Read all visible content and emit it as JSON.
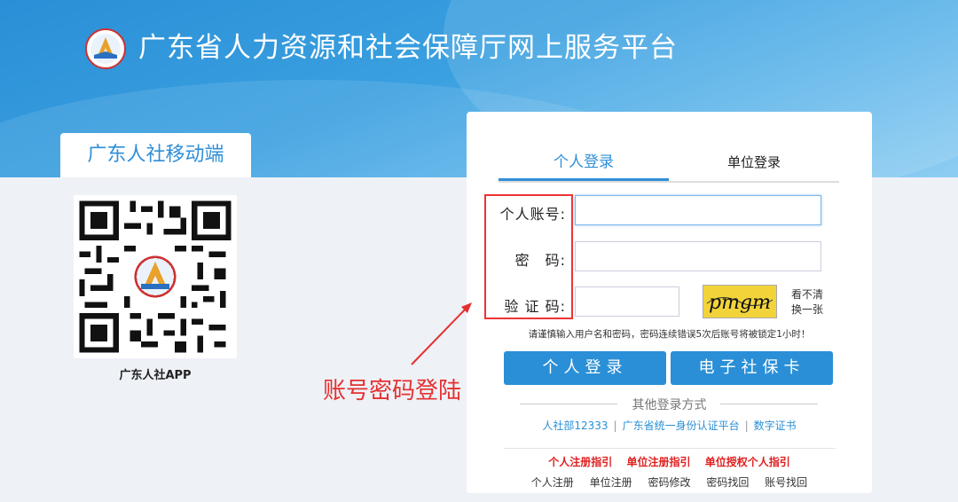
{
  "header": {
    "title": "广东省人力资源和社会保障厅网上服务平台",
    "logo_icon": "guangdong-hrss-emblem-icon"
  },
  "mobile": {
    "tab_label": "广东人社移动端",
    "qr_icon": "qr-code-icon",
    "app_label": "广东人社APP"
  },
  "login": {
    "tabs": [
      {
        "label": "个人登录",
        "active": true
      },
      {
        "label": "单位登录",
        "active": false
      }
    ],
    "fields": {
      "account_label": "个人账号:",
      "password_label": "密　码:",
      "captcha_label": "验 证 码:",
      "captcha_text": "pmgm",
      "refresh_label": "看不清换一张"
    },
    "tip": "请谨慎输入用户名和密码，密码连续错误5次后账号将被锁定1小时！",
    "buttons": {
      "personal": "个人登录",
      "ecard": "电子社保卡"
    },
    "other_title": "其他登录方式",
    "other_links": [
      "人社部12333",
      "广东省统一身份认证平台",
      "数字证书"
    ],
    "guide_links": [
      "个人注册指引",
      "单位注册指引",
      "单位授权个人指引"
    ],
    "bottom_links": [
      "个人注册",
      "单位注册",
      "密码修改",
      "密码找回",
      "账号找回"
    ]
  },
  "annotation": {
    "text": "账号密码登陆",
    "color": "#e53030"
  },
  "colors": {
    "brand_blue": "#2a8fd6",
    "accent_red": "#e02020"
  }
}
